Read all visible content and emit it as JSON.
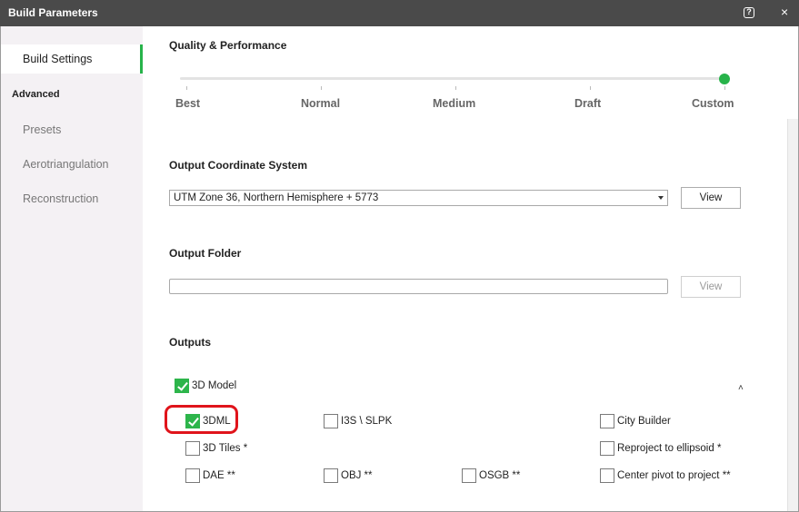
{
  "window": {
    "title": "Build Parameters",
    "help_icon": "help-icon",
    "close_icon": "close-icon",
    "close_glyph": "×",
    "help_glyph": "?"
  },
  "sidebar": {
    "build_settings": "Build Settings",
    "advanced_header": "Advanced",
    "presets": "Presets",
    "aerotriangulation": "Aerotriangulation",
    "reconstruction": "Reconstruction",
    "accent_color": "#27b34a"
  },
  "quality": {
    "title": "Quality & Performance",
    "levels": [
      "Best",
      "Normal",
      "Medium",
      "Draft",
      "Custom"
    ],
    "selected": "Custom"
  },
  "coordinate_system": {
    "title": "Output Coordinate System",
    "value": "UTM Zone 36, Northern Hemisphere + 5773",
    "view_label": "View"
  },
  "output_folder": {
    "title": "Output Folder",
    "value": "",
    "view_label": "View"
  },
  "outputs": {
    "title": "Outputs",
    "model": {
      "label": "3D Model",
      "checked": true
    },
    "collapse_glyph": "˄",
    "formats": {
      "3dml": {
        "label": "3DML",
        "checked": true
      },
      "i3s": {
        "label": "I3S \\ SLPK",
        "checked": false
      },
      "city_builder": {
        "label": "City Builder",
        "checked": false
      },
      "3d_tiles": {
        "label": "3D Tiles *",
        "checked": false
      },
      "reproject": {
        "label": "Reproject to ellipsoid *",
        "checked": false
      },
      "dae": {
        "label": "DAE **",
        "checked": false
      },
      "obj": {
        "label": "OBJ **",
        "checked": false
      },
      "osgb": {
        "label": "OSGB **",
        "checked": false
      },
      "center_pivot": {
        "label": "Center pivot to project **",
        "checked": false
      }
    },
    "highlight_color": "#e0141b"
  }
}
